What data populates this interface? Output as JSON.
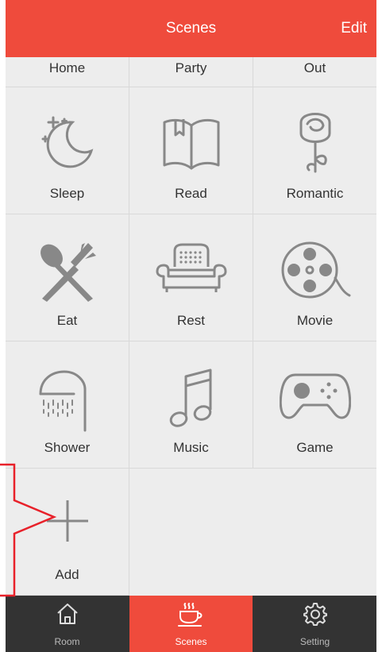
{
  "header": {
    "title": "Scenes",
    "edit_label": "Edit"
  },
  "top_row": [
    "Home",
    "Party",
    "Out"
  ],
  "scenes": [
    {
      "label": "Sleep",
      "icon": "moon-stars-icon"
    },
    {
      "label": "Read",
      "icon": "book-icon"
    },
    {
      "label": "Romantic",
      "icon": "rose-icon"
    },
    {
      "label": "Eat",
      "icon": "spoon-fork-icon"
    },
    {
      "label": "Rest",
      "icon": "armchair-icon"
    },
    {
      "label": "Movie",
      "icon": "film-reel-icon"
    },
    {
      "label": "Shower",
      "icon": "shower-icon"
    },
    {
      "label": "Music",
      "icon": "music-note-icon"
    },
    {
      "label": "Game",
      "icon": "gamepad-icon"
    }
  ],
  "add_label": "Add",
  "tabs": [
    {
      "label": "Room",
      "icon": "house-icon"
    },
    {
      "label": "Scenes",
      "icon": "coffee-cup-icon",
      "active": true
    },
    {
      "label": "Setting",
      "icon": "gear-icon"
    }
  ],
  "colors": {
    "accent": "#ef4b3c",
    "tabbar": "#333333",
    "background": "#ededed",
    "callout": "#e8212a"
  }
}
